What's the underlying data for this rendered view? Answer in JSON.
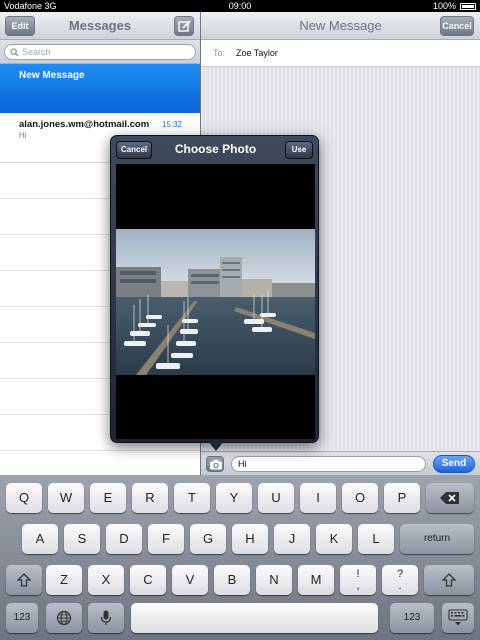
{
  "status_bar": {
    "carrier": "Vodafone 3G",
    "time": "09:00",
    "battery": "100%"
  },
  "left_pane": {
    "title": "Messages",
    "edit_label": "Edit",
    "search_placeholder": "Search",
    "selected": {
      "name": "New Message"
    },
    "conversations": [
      {
        "name": "alan.jones.wm@hotmail.com",
        "time": "15:32",
        "preview": "Hi"
      }
    ]
  },
  "right_pane": {
    "title": "New Message",
    "cancel_label": "Cancel",
    "to_label": "To:",
    "to_value": "Zoe Taylor"
  },
  "popover": {
    "title": "Choose Photo",
    "cancel_label": "Cancel",
    "use_label": "Use"
  },
  "compose": {
    "text": "Hi",
    "send_label": "Send"
  },
  "keyboard": {
    "row1": [
      "Q",
      "W",
      "E",
      "R",
      "T",
      "Y",
      "U",
      "I",
      "O",
      "P"
    ],
    "row2": [
      "A",
      "S",
      "D",
      "F",
      "G",
      "H",
      "J",
      "K",
      "L"
    ],
    "row3": [
      "Z",
      "X",
      "C",
      "V",
      "B",
      "N",
      "M"
    ],
    "return_label": "return",
    "num_label": "123",
    "excl_top": "!",
    "excl_bottom": ",",
    "quest_top": "?",
    "quest_bottom": "."
  },
  "colors": {
    "accent": "#0a66d9",
    "send": "#1f62e0",
    "popover": "#1d2534"
  }
}
